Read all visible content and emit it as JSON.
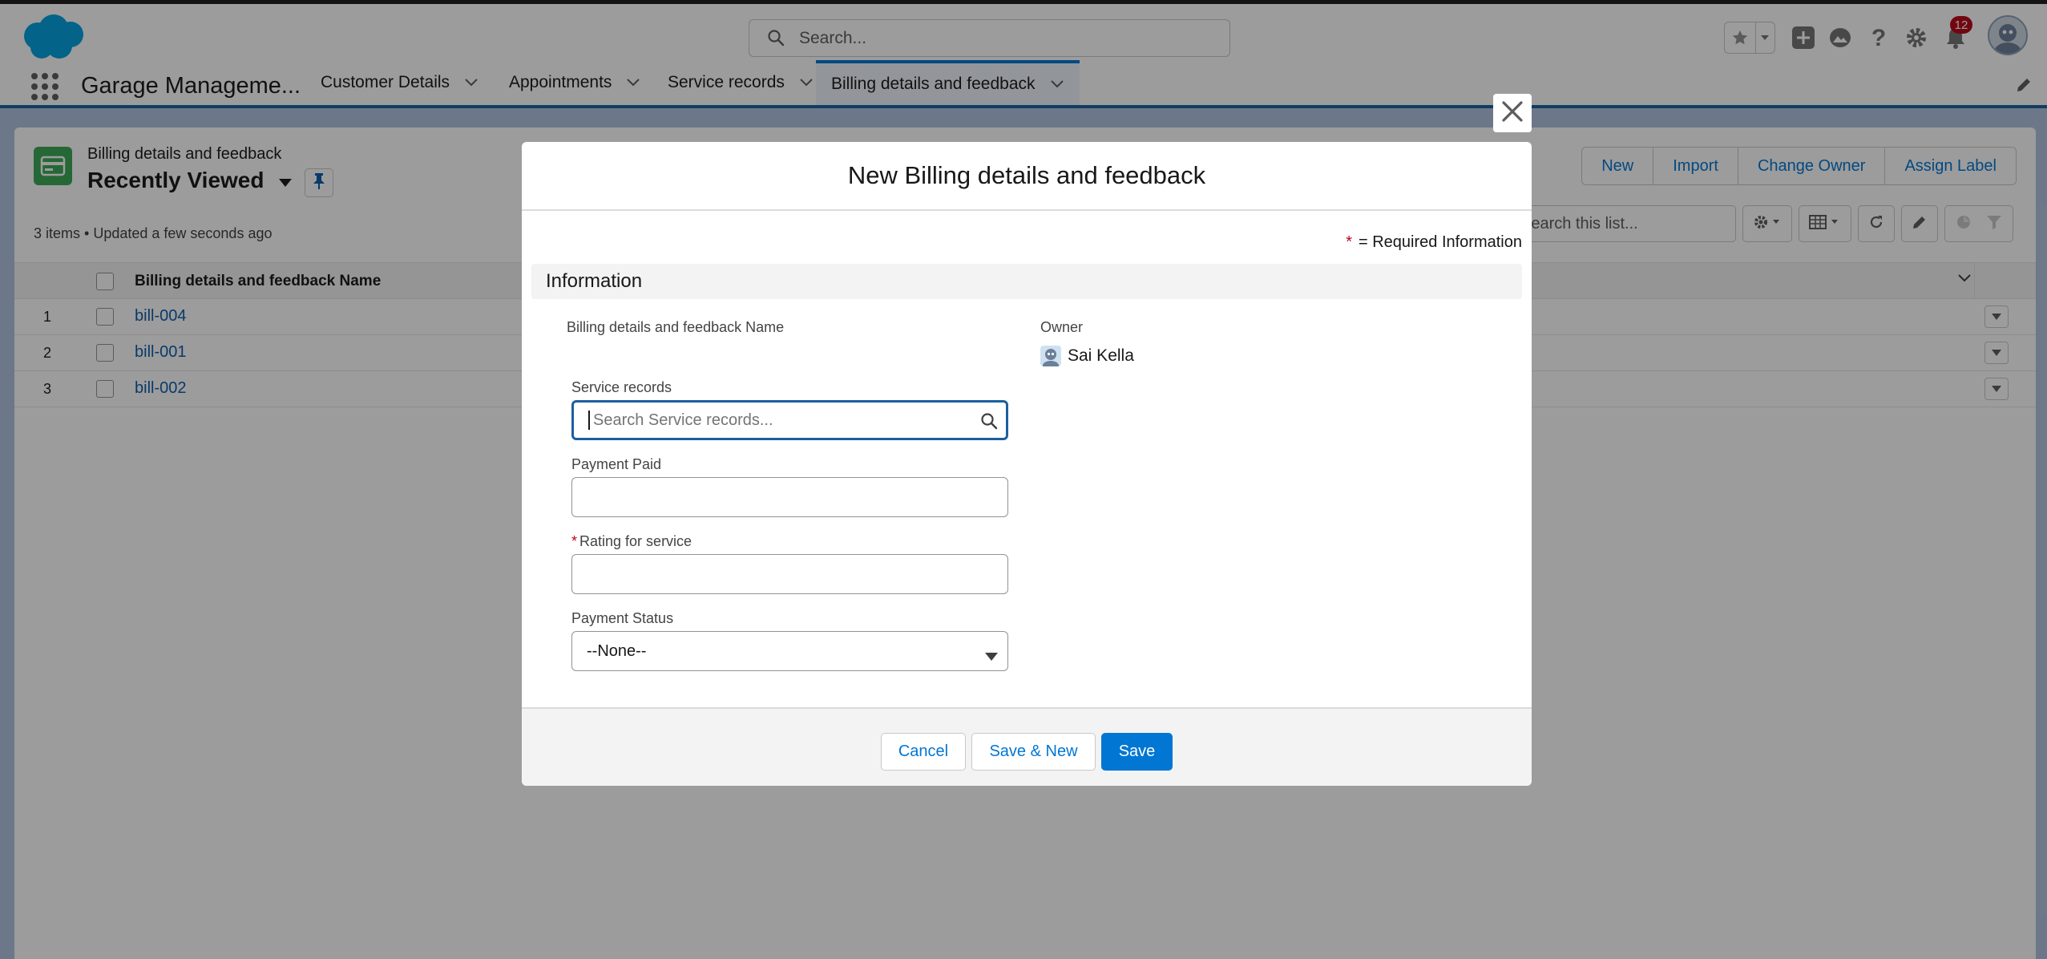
{
  "header": {
    "search_placeholder": "Search...",
    "notification_count": "12",
    "icons": [
      "salesforce-cloud-logo",
      "search-icon",
      "star-icon",
      "chevron-down-icon",
      "add-icon",
      "trailhead-icon",
      "help-icon",
      "gear-icon",
      "bell-icon",
      "avatar"
    ]
  },
  "nav": {
    "app_name": "Garage Manageme...",
    "tabs": [
      {
        "label": "Customer Details"
      },
      {
        "label": "Appointments"
      },
      {
        "label": "Service records"
      },
      {
        "label": "Billing details and feedback",
        "active": true
      }
    ]
  },
  "list_view": {
    "object_label": "Billing details and feedback",
    "title": "Recently Viewed",
    "meta": "3 items • Updated a few seconds ago",
    "actions": [
      "New",
      "Import",
      "Change Owner",
      "Assign Label"
    ],
    "search_placeholder": "Search this list...",
    "column_header": "Billing details and feedback Name",
    "rows": [
      {
        "num": "1",
        "name": "bill-004"
      },
      {
        "num": "2",
        "name": "bill-001"
      },
      {
        "num": "3",
        "name": "bill-002"
      }
    ]
  },
  "modal": {
    "title": "New Billing details and feedback",
    "required_note": "= Required Information",
    "required_star": "*",
    "section_title": "Information",
    "fields": {
      "name_label": "Billing details and feedback Name",
      "owner_label": "Owner",
      "owner_value": "Sai Kella",
      "service_records_label": "Service records",
      "service_records_placeholder": "Search Service records...",
      "payment_paid_label": "Payment Paid",
      "payment_paid_value": "",
      "rating_label": "Rating for service",
      "rating_value": "",
      "payment_status_label": "Payment Status",
      "payment_status_value": "--None--"
    },
    "buttons": {
      "cancel": "Cancel",
      "save_new": "Save & New",
      "save": "Save"
    }
  },
  "colors": {
    "brand": "#0176d3",
    "link": "#0b5cab",
    "required": "#ba0517",
    "object_icon": "#3ba755",
    "nav_accent": "#1b5fa0"
  }
}
